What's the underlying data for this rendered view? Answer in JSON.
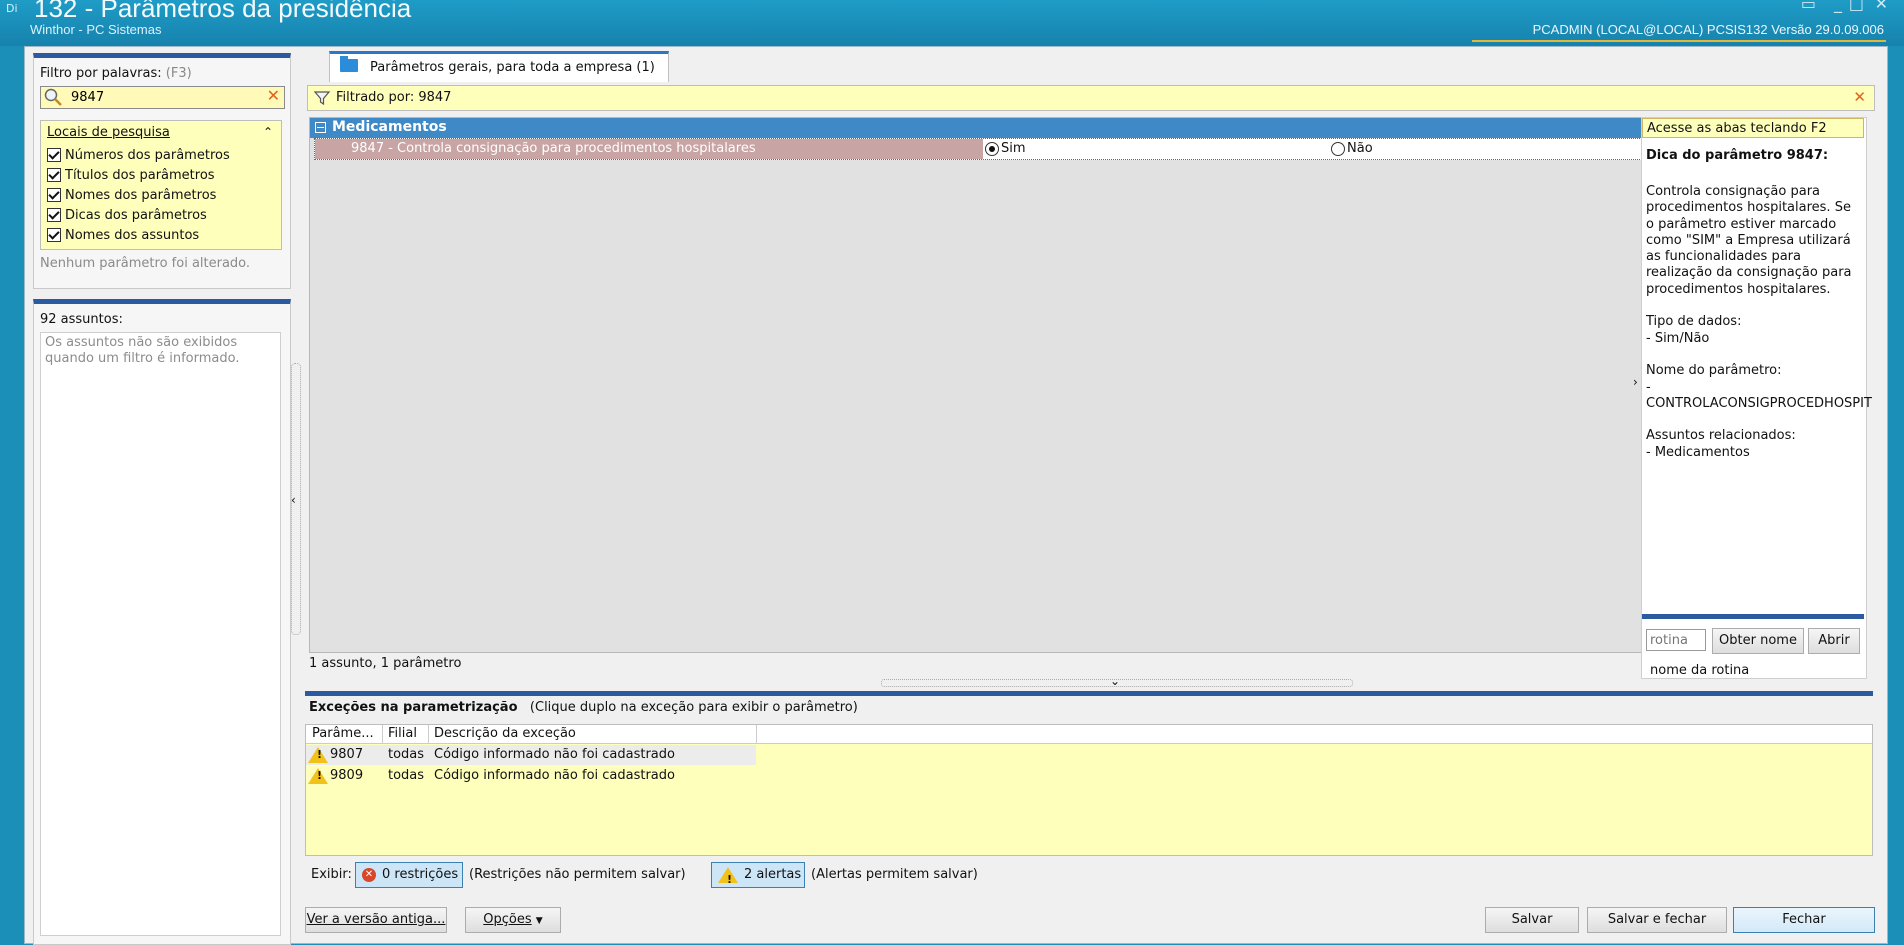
{
  "titlebar": {
    "app_icon": "Di",
    "title": "132 - Parâmetros da presidência",
    "subtitle": "Winthor - PC Sistemas",
    "userinfo": "PCADMIN (LOCAL@LOCAL)   PCSIS132  Versão  29.0.09.006"
  },
  "left": {
    "filter_label": "Filtro por palavras:",
    "filter_hint": "(F3)",
    "search_value": "9847",
    "locais_header": "Locais de pesquisa",
    "options": [
      "Números dos parâmetros",
      "Títulos dos parâmetros",
      "Nomes dos parâmetros",
      "Dicas dos parâmetros",
      "Nomes dos assuntos"
    ],
    "no_change": "Nenhum parâmetro foi alterado.",
    "assuntos_header": "92 assuntos:",
    "assuntos_note": "Os assuntos não são exibidos quando um filtro é informado."
  },
  "main": {
    "tab_label": "Parâmetros gerais, para toda a empresa  (1)",
    "filtered_by": "Filtrado por: 9847",
    "group": "Medicamentos",
    "param_desc": "9847 - Controla consignação para procedimentos hospitalares",
    "option_yes": "Sim",
    "option_no": "Não",
    "status_count": "1 assunto, 1 parâmetro"
  },
  "dica": {
    "tab_hint": "Acesse as abas teclando F2",
    "title": "Dica do parâmetro 9847:",
    "body": "Controla consignação para procedimentos hospitalares. Se o parâmetro estiver marcado como \"SIM\" a Empresa utilizará as funcionalidades para realização da consignação para procedimentos hospitalares.\n\nTipo de dados:\n  - Sim/Não\n\nNome do parâmetro:\n  -\nCONTROLACONSIGPROCEDHOSPIT\n\nAssuntos relacionados:\n  - Medicamentos",
    "rotina_placeholder": "rotina",
    "obter_nome": "Obter nome",
    "abrir": "Abrir",
    "nome_rotina": "nome da rotina"
  },
  "excecoes": {
    "title": "Exceções na parametrização",
    "hint": "(Clique duplo na exceção para exibir o parâmetro)",
    "columns": [
      "Parâme...",
      "Filial",
      "Descrição da exceção"
    ],
    "rows": [
      {
        "param": "9807",
        "filial": "todas",
        "desc": "Código informado não foi cadastrado"
      },
      {
        "param": "9809",
        "filial": "todas",
        "desc": "Código informado não foi cadastrado"
      }
    ],
    "exibir_label": "Exibir:",
    "restricoes_btn": "0 restrições",
    "restricoes_note": "(Restrições não permitem salvar)",
    "alertas_btn": "2 alertas",
    "alertas_note": "(Alertas permitem salvar)"
  },
  "footer": {
    "ver_versao": "Ver a versão antiga...",
    "opcoes": "Opções",
    "salvar": "Salvar",
    "salvar_fechar": "Salvar e fechar",
    "fechar": "Fechar"
  }
}
